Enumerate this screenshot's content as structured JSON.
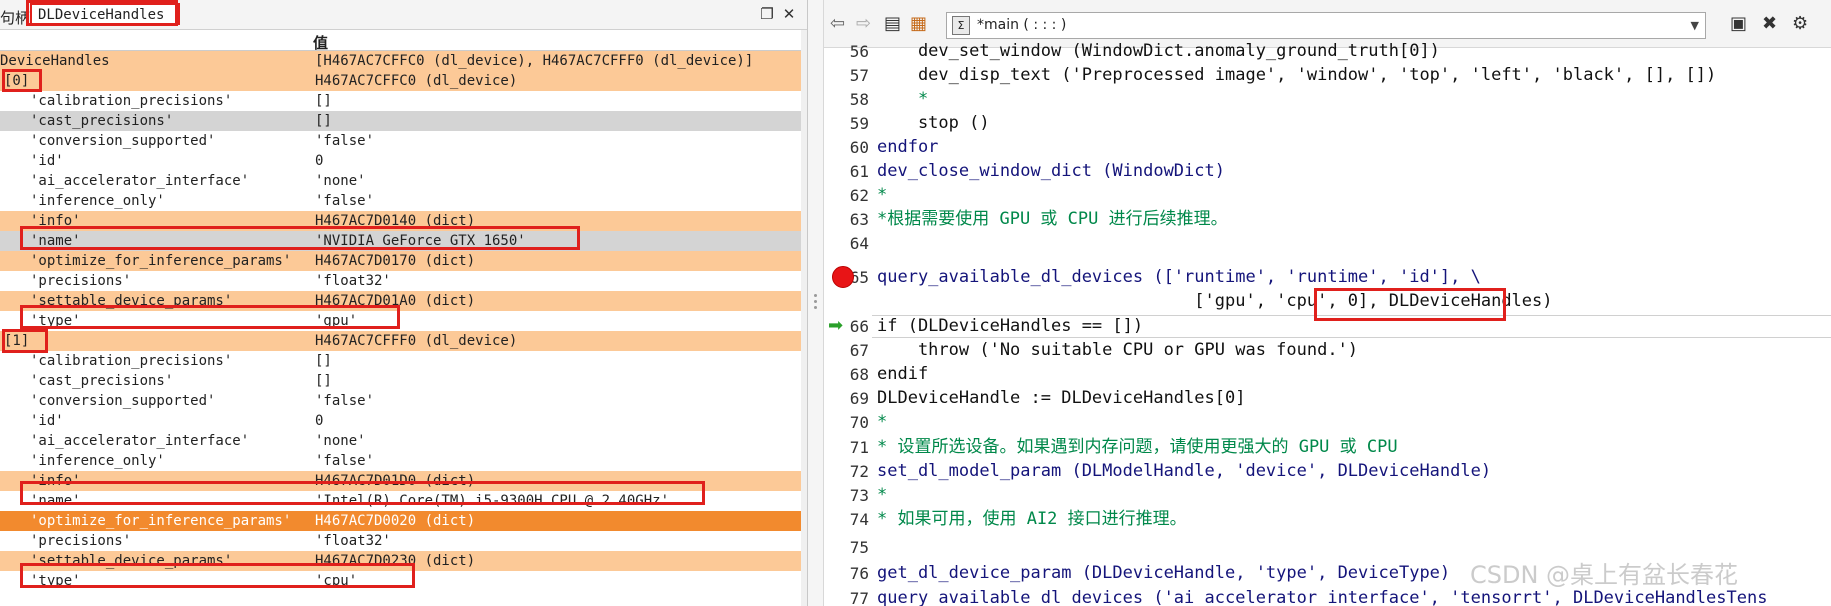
{
  "variables_panel": {
    "title_prefix": "句柄:",
    "current_variable": "DLDeviceHandles",
    "column_value_header": "值",
    "rows": [
      {
        "name": "DeviceHandles",
        "value": "[H467AC7CFFC0 (dl_device), H467AC7CFFF0 (dl_device)]",
        "bg": "o",
        "indent": 0
      },
      {
        "name": "[0]",
        "value": "H467AC7CFFC0 (dl_device)",
        "bg": "o",
        "indent": 1
      },
      {
        "name": "'calibration_precisions'",
        "value": "[]",
        "bg": "w",
        "indent": 2
      },
      {
        "name": "'cast_precisions'",
        "value": "[]",
        "bg": "g",
        "indent": 2
      },
      {
        "name": "'conversion_supported'",
        "value": "'false'",
        "bg": "w",
        "indent": 2
      },
      {
        "name": "'id'",
        "value": "0",
        "bg": "w",
        "indent": 2
      },
      {
        "name": "'ai_accelerator_interface'",
        "value": "'none'",
        "bg": "w",
        "indent": 2
      },
      {
        "name": "'inference_only'",
        "value": "'false'",
        "bg": "w",
        "indent": 2
      },
      {
        "name": "'info'",
        "value": "H467AC7D0140 (dict)",
        "bg": "o",
        "indent": 2
      },
      {
        "name": "'name'",
        "value": "'NVIDIA GeForce GTX 1650'",
        "bg": "g",
        "indent": 2
      },
      {
        "name": "'optimize_for_inference_params'",
        "value": "H467AC7D0170 (dict)",
        "bg": "o",
        "indent": 2
      },
      {
        "name": "'precisions'",
        "value": "'float32'",
        "bg": "w",
        "indent": 2
      },
      {
        "name": "'settable_device_params'",
        "value": "H467AC7D01A0 (dict)",
        "bg": "o",
        "indent": 2
      },
      {
        "name": "'type'",
        "value": "'gpu'",
        "bg": "w",
        "indent": 2
      },
      {
        "name": "[1]",
        "value": "H467AC7CFFF0 (dl_device)",
        "bg": "o",
        "indent": 1
      },
      {
        "name": "'calibration_precisions'",
        "value": "[]",
        "bg": "w",
        "indent": 2
      },
      {
        "name": "'cast_precisions'",
        "value": "[]",
        "bg": "w",
        "indent": 2
      },
      {
        "name": "'conversion_supported'",
        "value": "'false'",
        "bg": "w",
        "indent": 2
      },
      {
        "name": "'id'",
        "value": "0",
        "bg": "w",
        "indent": 2
      },
      {
        "name": "'ai_accelerator_interface'",
        "value": "'none'",
        "bg": "w",
        "indent": 2
      },
      {
        "name": "'inference_only'",
        "value": "'false'",
        "bg": "w",
        "indent": 2
      },
      {
        "name": "'info'",
        "value": "H467AC7D01D0 (dict)",
        "bg": "o",
        "indent": 2
      },
      {
        "name": "'name'",
        "value": "'Intel(R) Core(TM) i5-9300H CPU @ 2.40GHz'",
        "bg": "w",
        "indent": 2
      },
      {
        "name": "'optimize_for_inference_params'",
        "value": "H467AC7D0020 (dict)",
        "bg": "O",
        "indent": 2
      },
      {
        "name": "'precisions'",
        "value": "'float32'",
        "bg": "w",
        "indent": 2
      },
      {
        "name": "'settable_device_params'",
        "value": "H467AC7D0230 (dict)",
        "bg": "o",
        "indent": 2
      },
      {
        "name": "'type'",
        "value": "'cpu'",
        "bg": "w",
        "indent": 2
      }
    ]
  },
  "editor": {
    "procedure_selector": "*main ( : : : )",
    "current_line": "66",
    "breakpoint_line": "65",
    "lines": [
      {
        "num": "56",
        "text": "    dev_set_window (WindowDict.anomaly_ground_truth[0])",
        "kind": "code"
      },
      {
        "num": "57",
        "text": "    dev_disp_text ('Preprocessed image', 'window', 'top', 'left', 'black', [], [])",
        "kind": "code"
      },
      {
        "num": "58",
        "text": "    *",
        "kind": "comment"
      },
      {
        "num": "59",
        "text": "    stop ()",
        "kind": "code"
      },
      {
        "num": "60",
        "text": "endfor",
        "kind": "keyword"
      },
      {
        "num": "61",
        "text": "dev_close_window_dict (WindowDict)",
        "kind": "keyword"
      },
      {
        "num": "62",
        "text": "*",
        "kind": "comment"
      },
      {
        "num": "63",
        "text": "*根据需要使用 GPU 或 CPU 进行后续推理。",
        "kind": "comment"
      },
      {
        "num": "64",
        "text": "",
        "kind": "code"
      },
      {
        "num": "65",
        "text": "query_available_dl_devices (['runtime', 'runtime', 'id'], \\",
        "kind": "keyword"
      },
      {
        "num": "",
        "text": "                               ['gpu', 'cpu', 0], DLDeviceHandles)",
        "kind": "code"
      },
      {
        "num": "66",
        "text": "if (DLDeviceHandles == [])",
        "kind": "code"
      },
      {
        "num": "67",
        "text": "    throw ('No suitable CPU or GPU was found.')",
        "kind": "code"
      },
      {
        "num": "68",
        "text": "endif",
        "kind": "code"
      },
      {
        "num": "69",
        "text": "DLDeviceHandle := DLDeviceHandles[0]",
        "kind": "code"
      },
      {
        "num": "70",
        "text": "*",
        "kind": "comment"
      },
      {
        "num": "71",
        "text": "* 设置所选设备。如果遇到内存问题，请使用更强大的 GPU 或 CPU",
        "kind": "comment"
      },
      {
        "num": "72",
        "text": "set_dl_model_param (DLModelHandle, 'device', DLDeviceHandle)",
        "kind": "keyword"
      },
      {
        "num": "73",
        "text": "*",
        "kind": "comment"
      },
      {
        "num": "74",
        "text": "* 如果可用，使用 AI2 接口进行推理。",
        "kind": "comment"
      },
      {
        "num": "75",
        "text": "",
        "kind": "code"
      },
      {
        "num": "76",
        "text": "get_dl_device_param (DLDeviceHandle, 'type', DeviceType)",
        "kind": "keyword"
      },
      {
        "num": "77",
        "text": "query_available_dl_devices ('ai_accelerator_interface', 'tensorrt', DLDeviceHandlesTens",
        "kind": "keyword"
      }
    ]
  },
  "watermark": "CSDN @桌上有盆长春花",
  "icons": {
    "restore": "restore-window-icon",
    "close": "close-icon",
    "back": "arrow-left-icon",
    "forward": "arrow-right-icon",
    "clipboard": "clipboard-icon",
    "grid": "grid-icon",
    "procedure": "procedure-icon",
    "dropdown": "chevron-down-icon",
    "edit": "edit-procedure-icon",
    "tool": "tool-icon",
    "settings": "settings-icon"
  }
}
